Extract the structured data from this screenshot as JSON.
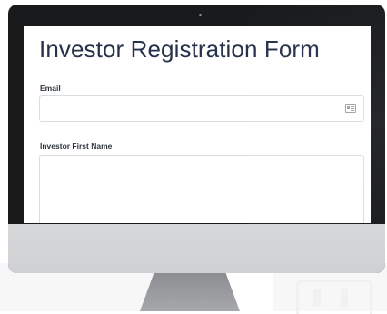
{
  "form": {
    "title": "Investor Registration Form",
    "fields": [
      {
        "label": "Email",
        "value": "",
        "icon": "contact-card-icon"
      },
      {
        "label": "Investor First Name",
        "value": ""
      }
    ]
  },
  "colors": {
    "title": "#26324a",
    "monitor_bezel": "#191a1c",
    "monitor_chin": "#d7d8da",
    "input_border": "#d9dde2"
  }
}
